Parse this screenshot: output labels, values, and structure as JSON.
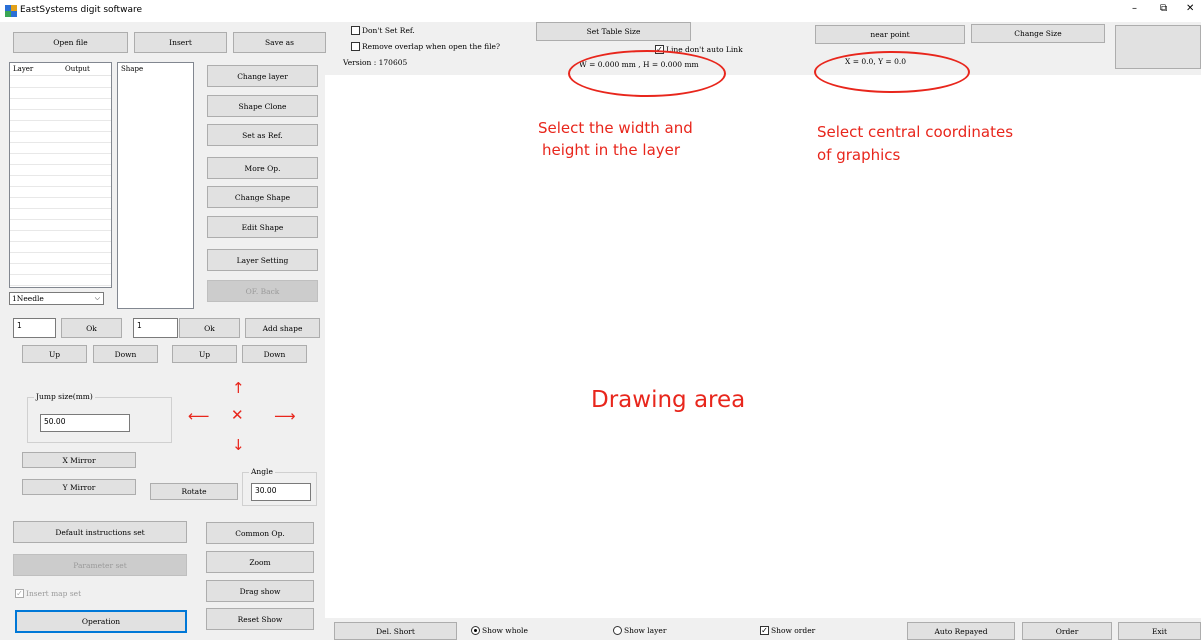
{
  "window": {
    "title": "EastSystems digit software",
    "controls": {
      "minimize": "–",
      "restore": "⧉",
      "close": "✕"
    }
  },
  "top_left_buttons": {
    "open_file": "Open file",
    "insert": "Insert",
    "save_as": "Save as"
  },
  "layer_list": {
    "col_layer": "Layer",
    "col_output": "Output"
  },
  "shape_list": {
    "col_shape": "Shape"
  },
  "side_buttons": {
    "change_layer": "Change layer",
    "shape_clone": "Shape Clone",
    "set_as_ref": "Set as Ref.",
    "more_op": "More Op.",
    "change_shape": "Change Shape",
    "edit_shape": "Edit Shape",
    "layer_setting": "Layer Setting",
    "of_back": "OF. Back"
  },
  "needle_select": {
    "value": "1Needle"
  },
  "layer_ok": {
    "value": "1",
    "ok": "Ok",
    "up": "Up",
    "down": "Down"
  },
  "shape_ok": {
    "value": "1",
    "ok": "Ok",
    "up": "Up",
    "down": "Down"
  },
  "add_shape": "Add shape",
  "jump": {
    "label": "Jump size(mm)",
    "value": "50.00"
  },
  "mirror": {
    "x": "X Mirror",
    "y": "Y Mirror"
  },
  "rotate": {
    "button": "Rotate",
    "angle_label": "Angle",
    "angle_value": "30.00"
  },
  "bottom_left": {
    "default_instructions": "Default instructions set",
    "parameter_set": "Parameter set",
    "insert_map_set": "Insert map set",
    "operation": "Operation",
    "common_op": "Common Op.",
    "zoom": "Zoom",
    "drag_show": "Drag show",
    "reset_show": "Reset Show"
  },
  "top_options": {
    "dont_set_ref": "Don't Set Ref.",
    "remove_overlap": "Remove overlap when open the file?",
    "version": "Version :  170605",
    "set_table_size": "Set Table Size",
    "line_dont_auto_link": "Line don't auto Link",
    "wh_readout": "W = 0.000 mm , H = 0.000 mm",
    "near_point": "near point",
    "change_size": "Change Size",
    "xy_readout": "X = 0.0, Y = 0.0"
  },
  "annotations": {
    "width_height_line1": "Select the width and",
    "width_height_line2": "height in the layer",
    "central_line1": "Select central coordinates",
    "central_line2": "of graphics",
    "drawing_area": "Drawing area"
  },
  "bottom_bar": {
    "del_short": "Del. Short",
    "show_whole": "Show whole",
    "show_layer": "Show layer",
    "show_order": "Show order",
    "auto_repaved": "Auto Repayed",
    "order": "Order",
    "exit": "Exit"
  },
  "colors": {
    "annotation": "#e8261c",
    "focus": "#0078d7",
    "button": "#e1e1e1"
  }
}
